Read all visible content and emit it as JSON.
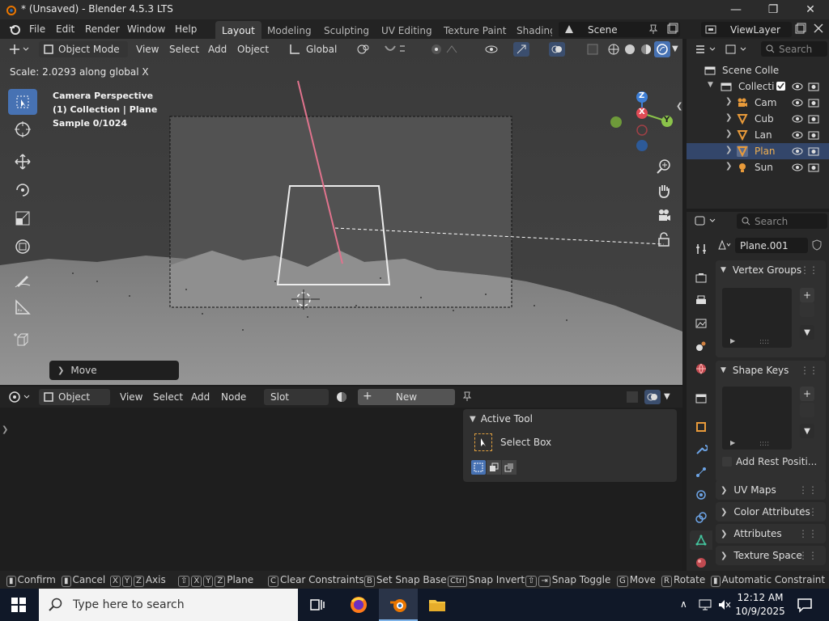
{
  "titlebar": {
    "title": "* (Unsaved) - Blender 4.5.3 LTS"
  },
  "menu": {
    "file": "File",
    "edit": "Edit",
    "render": "Render",
    "window": "Window",
    "help": "Help"
  },
  "workspaces": [
    "Layout",
    "Modeling",
    "Sculpting",
    "UV Editing",
    "Texture Paint",
    "Shading"
  ],
  "scene": {
    "name": "Scene",
    "view_layer": "ViewLayer"
  },
  "viewport": {
    "mode": "Object Mode",
    "menus": [
      "View",
      "Select",
      "Add",
      "Object"
    ],
    "orientation": "Global",
    "status": "Scale: 2.0293 along global X",
    "overlay_lines": [
      "Camera Perspective",
      "(1) Collection | Plane",
      "Sample 0/1024"
    ],
    "last_op": "Move",
    "gizmo": {
      "z": "Z",
      "x": "X",
      "y": "Y"
    }
  },
  "shader": {
    "type": "Object",
    "menus": [
      "View",
      "Select",
      "Add",
      "Node"
    ],
    "slot": "Slot",
    "new_label": "New",
    "active_tool_title": "Active Tool",
    "active_tool_name": "Select Box"
  },
  "outliner": {
    "search_placeholder": "Search",
    "scene_collection": "Scene Colle",
    "collection": "Collecti",
    "items": [
      "Cam",
      "Cub",
      "Lan",
      "Plan",
      "Sun"
    ]
  },
  "properties": {
    "search_placeholder": "Search",
    "mesh_name": "Plane.001",
    "vertex_groups": "Vertex Groups",
    "shape_keys": "Shape Keys",
    "add_rest": "Add Rest Positi...",
    "uv_maps": "UV Maps",
    "color_attributes": "Color Attributes",
    "attributes": "Attributes",
    "texture_space": "Texture Space"
  },
  "statusbar": {
    "confirm": "Confirm",
    "cancel": "Cancel",
    "axis": "Axis",
    "plane": "Plane",
    "clear_constraints": "Clear Constraints",
    "snap_base": "Set Snap Base",
    "ctrl": "Ctrl",
    "snap_invert": "Snap Invert",
    "snap_toggle": "Snap Toggle",
    "move": "Move",
    "rotate": "Rotate",
    "auto_constraint": "Automatic Constraint",
    "keys": {
      "x": "X",
      "y": "Y",
      "z": "Z",
      "c": "C",
      "b": "B",
      "g": "G",
      "r": "R"
    }
  },
  "taskbar": {
    "search": "Type here to search",
    "time": "12:12 AM",
    "date": "10/9/2025"
  },
  "colors": {
    "accent": "#4772b3",
    "selected_row": "#33466a",
    "axis_x": "#e04a55",
    "axis_y": "#8bc34a",
    "axis_z": "#3e7fd6"
  }
}
